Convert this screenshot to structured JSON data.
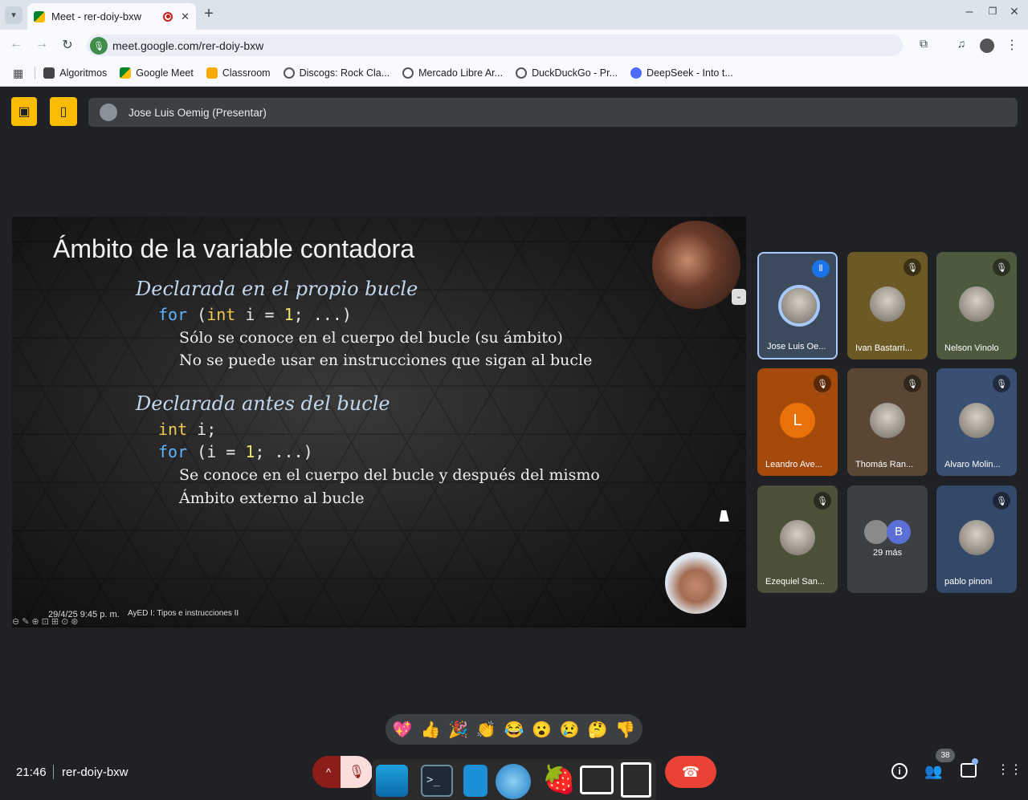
{
  "browser": {
    "tab_title": "Meet - rer-doiy-bxw",
    "url": "meet.google.com/rer-doiy-bxw",
    "bookmarks": [
      "Algoritmos",
      "Google Meet",
      "Classroom",
      "Discogs: Rock Cla...",
      "Mercado Libre Ar...",
      "DuckDuckGo - Pr...",
      "DeepSeek - Into t..."
    ]
  },
  "meet": {
    "presenter_label": "Jose Luis Oemig (Presentar)",
    "time": "21:46",
    "meeting_code": "rer-doiy-bxw",
    "participants_count": "38",
    "more_label": "29 más",
    "more_initial": "B",
    "tiles": [
      {
        "name": "Jose Luis Oe...",
        "bg": "#3b4a5c",
        "speaking": true
      },
      {
        "name": "Ivan Bastarri...",
        "bg": "#6b5a26",
        "speaking": false
      },
      {
        "name": "Nelson Vinolo",
        "bg": "#4d5a40",
        "speaking": false
      },
      {
        "name": "Leandro Ave...",
        "bg": "#a34a0c",
        "initial": "L",
        "speaking": false
      },
      {
        "name": "Thomás Ran...",
        "bg": "#5a4634",
        "speaking": false
      },
      {
        "name": "Alvaro Molin...",
        "bg": "#3b4f72",
        "speaking": false
      },
      {
        "name": "Ezequiel San...",
        "bg": "#4a5138",
        "speaking": false
      },
      {
        "name": "pablo pinoni",
        "bg": "#34496a",
        "speaking": false
      }
    ],
    "reactions": [
      "💖",
      "👍",
      "🎉",
      "👏",
      "😂",
      "😮",
      "😢",
      "🤔",
      "👎"
    ]
  },
  "slide": {
    "title": "Ámbito de la variable contadora",
    "section1": "Declarada en el propio bucle",
    "line1_kw": "for",
    "line1_a": " (",
    "line1_type": "int",
    "line1_b": " i = ",
    "line1_num": "1",
    "line1_c": "; ...)",
    "s1_text1": "Sólo se conoce en el cuerpo del bucle (su ámbito)",
    "s1_text2": "No se puede usar en instrucciones que sigan al bucle",
    "section2": "Declarada antes del bucle",
    "line2_type": "int",
    "line2_rest": " i;",
    "line3_kw": "for",
    "line3_a": " (i = ",
    "line3_num": "1",
    "line3_b": "; ...)",
    "s2_text1": "Se conoce en el cuerpo del bucle y después del mismo",
    "s2_text2": "Ámbito externo al bucle",
    "footer_date": "29/4/25 9:45 p. m.",
    "footer_title": "AyED I: Tipos e instrucciones II"
  }
}
